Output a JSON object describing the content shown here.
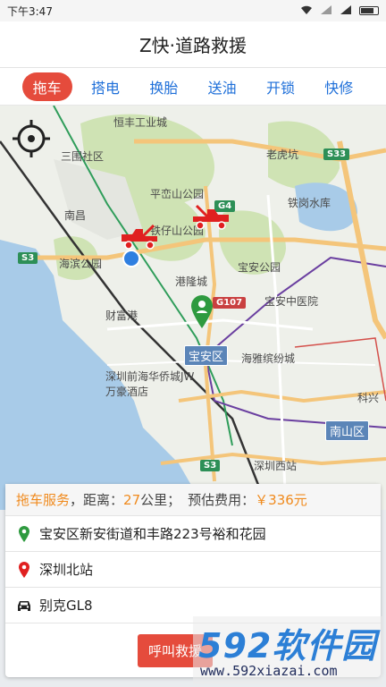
{
  "status_bar": {
    "time": "下午3:47"
  },
  "header": {
    "title": "Z快·道路救援"
  },
  "tabs": [
    {
      "label": "拖车",
      "active": true
    },
    {
      "label": "搭电",
      "active": false
    },
    {
      "label": "换胎",
      "active": false
    },
    {
      "label": "送油",
      "active": false
    },
    {
      "label": "开锁",
      "active": false
    },
    {
      "label": "快修",
      "active": false
    }
  ],
  "map": {
    "labels": {
      "hengfeng": "恒丰工业城",
      "sanwei": "三围社区",
      "laohu": "老虎坑",
      "pingluan": "平峦山公园",
      "tiegang": "铁岗水库",
      "nanchang": "南昌",
      "tiezai": "铁仔山公园",
      "haibin": "海滨公园",
      "ganglong": "港隆城",
      "baoan_park": "宝安公园",
      "baoan_hosp": "宝安中医院",
      "caifu": "财富港",
      "yajin": "海雅缤纷城",
      "qianhai": "深圳前海华侨城JW万豪酒店",
      "kejixing": "科兴",
      "shenzhenxi": "深圳西站"
    },
    "roads": {
      "s33": "S33",
      "g4": "G4",
      "s3a": "S3",
      "g107": "G107",
      "s3b": "S3"
    },
    "districts": {
      "baoan": "宝安区",
      "nanshan": "南山区"
    }
  },
  "panel": {
    "service": "拖车服务",
    "distance_label": "，距离：",
    "distance_value": "27",
    "distance_unit": "公里；",
    "cost_label": "预估费用：",
    "cost_value": "￥336元",
    "start_address": "宝安区新安街道和丰路223号裕和花园",
    "destination": "深圳北站",
    "car_model": "别克GL8",
    "call_button": "呼叫救援"
  },
  "watermark": {
    "brand": "592软件园",
    "url": "www.592xiazai.com"
  },
  "colors": {
    "accent": "#e54b3c",
    "tab_text": "#1e6fd9",
    "orange": "#f08a1d",
    "green_pin": "#2e9a3f",
    "red_pin": "#e02020"
  }
}
